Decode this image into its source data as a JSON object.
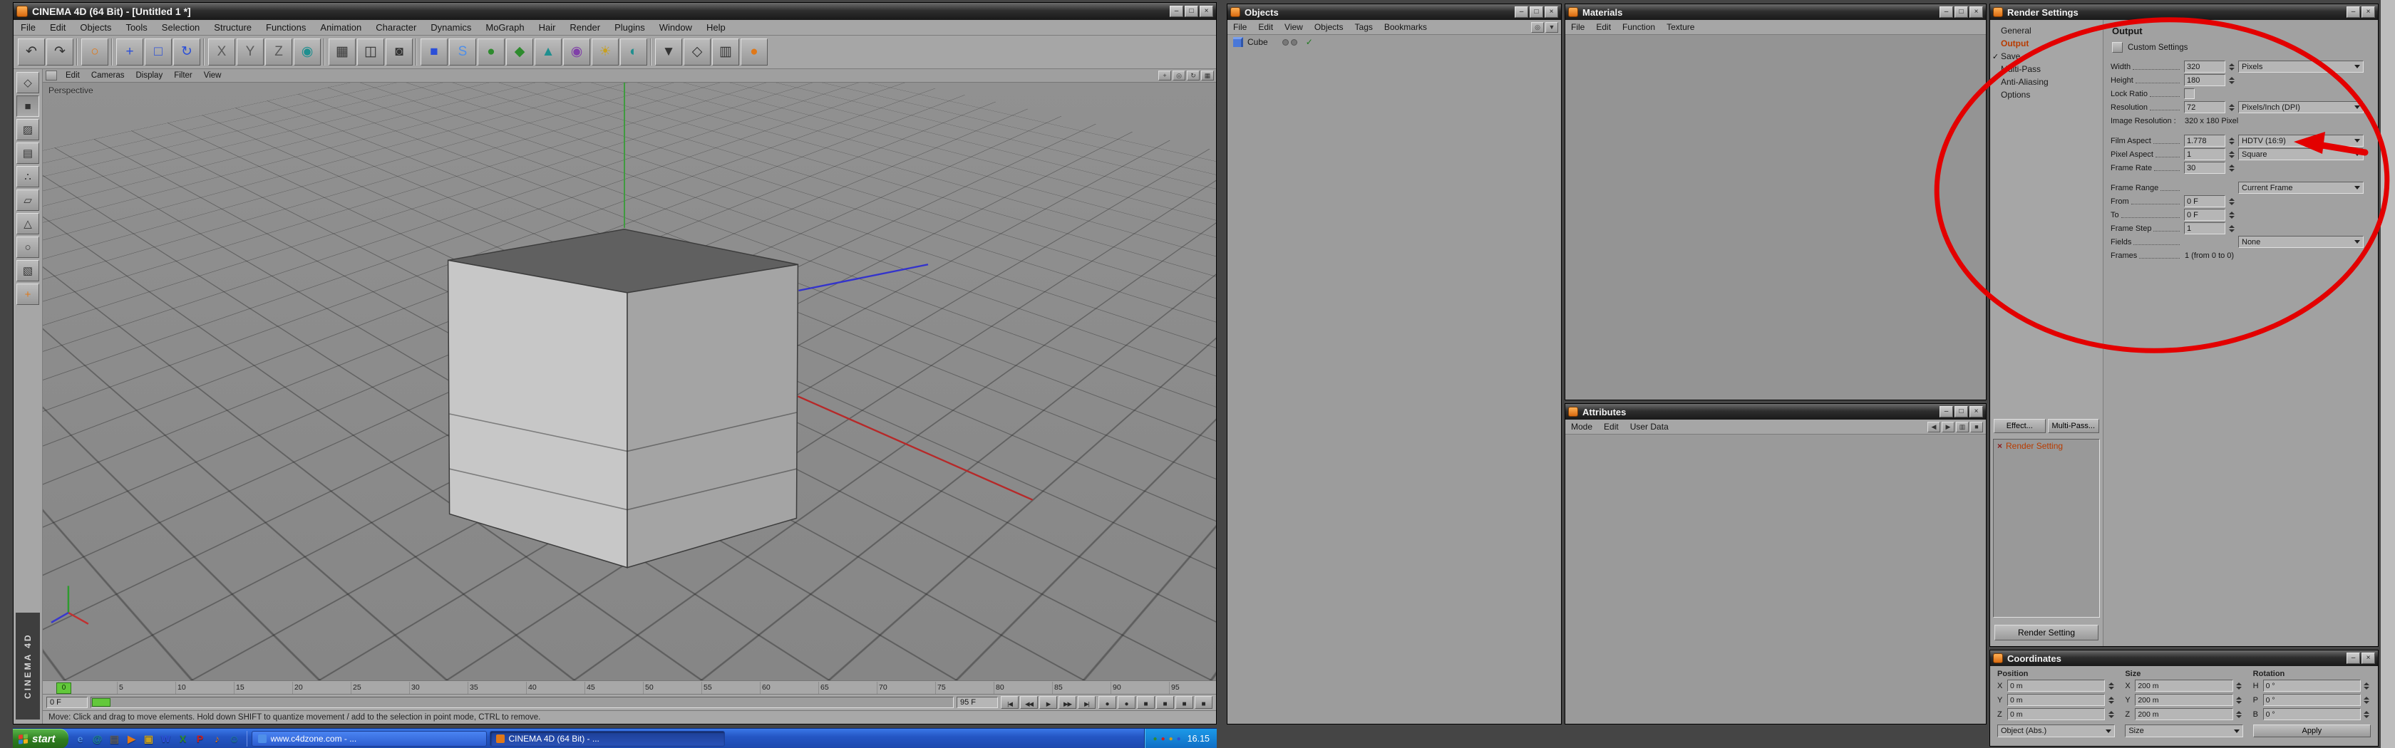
{
  "annotations": {
    "color": "#e30000"
  },
  "main_window": {
    "title": "CINEMA 4D (64 Bit) - [Untitled 1 *]",
    "brand": "CINEMA 4D",
    "menus": [
      "File",
      "Edit",
      "Objects",
      "Tools",
      "Selection",
      "Structure",
      "Functions",
      "Animation",
      "Character",
      "Dynamics",
      "MoGraph",
      "Hair",
      "Render",
      "Plugins",
      "Window",
      "Help"
    ],
    "window_buttons": [
      {
        "name": "minimize-button",
        "glyph": "–"
      },
      {
        "name": "maximize-button",
        "glyph": "□"
      },
      {
        "name": "close-button",
        "glyph": "×"
      }
    ],
    "toolbar_icons": [
      {
        "name": "undo-icon",
        "glyph": "↶",
        "tone": "dark"
      },
      {
        "name": "redo-icon",
        "glyph": "↷",
        "tone": "dark"
      },
      {
        "sep": true
      },
      {
        "name": "live-selection-icon",
        "glyph": "○",
        "tone": "orange"
      },
      {
        "sep": true
      },
      {
        "name": "move-icon",
        "glyph": "+",
        "tone": "blue"
      },
      {
        "name": "scale-icon",
        "glyph": "□",
        "tone": "blue"
      },
      {
        "name": "rotate-icon",
        "glyph": "↻",
        "tone": "blue"
      },
      {
        "sep": true
      },
      {
        "name": "lock-x-icon",
        "glyph": "X",
        "tone": "gray"
      },
      {
        "name": "lock-y-icon",
        "glyph": "Y",
        "tone": "gray"
      },
      {
        "name": "lock-z-icon",
        "glyph": "Z",
        "tone": "gray"
      },
      {
        "name": "coordinate-system-icon",
        "glyph": "◉",
        "tone": "teal"
      },
      {
        "sep": true
      },
      {
        "name": "render-view-icon",
        "glyph": "▦",
        "tone": "dark"
      },
      {
        "name": "render-picture-viewer-icon",
        "glyph": "◫",
        "tone": "dark"
      },
      {
        "name": "render-settings-icon",
        "glyph": "◙",
        "tone": "dark"
      },
      {
        "sep": true
      },
      {
        "name": "add-cube-icon",
        "glyph": "■",
        "tone": "blue"
      },
      {
        "name": "add-spline-icon",
        "glyph": "S",
        "tone": "lightblue"
      },
      {
        "name": "add-nurbs-icon",
        "glyph": "●",
        "tone": "green"
      },
      {
        "name": "add-modeling-icon",
        "glyph": "◆",
        "tone": "green"
      },
      {
        "name": "add-scene-icon",
        "glyph": "▲",
        "tone": "teal"
      },
      {
        "name": "add-camera-icon",
        "glyph": "◉",
        "tone": "purple"
      },
      {
        "name": "add-light-icon",
        "glyph": "☀",
        "tone": "yellow"
      },
      {
        "name": "add-environment-icon",
        "glyph": "◐",
        "tone": "teal"
      },
      {
        "sep": true
      },
      {
        "name": "selection-filter-icon",
        "glyph": "▼",
        "tone": "dark"
      },
      {
        "name": "snap-settings-icon",
        "glyph": "◇",
        "tone": "dark"
      },
      {
        "name": "viewport-layout-icon",
        "glyph": "▥",
        "tone": "dark"
      },
      {
        "name": "bodypaint-icon",
        "glyph": "●",
        "tone": "orange"
      }
    ],
    "palette_icons": [
      {
        "name": "convert-editable-icon",
        "glyph": "◇",
        "tone": "dark",
        "state": ""
      },
      {
        "name": "model-mode-icon",
        "glyph": "■",
        "tone": "dark",
        "state": "active"
      },
      {
        "name": "texture-mode-icon",
        "glyph": "▨",
        "tone": "dark",
        "state": ""
      },
      {
        "name": "workplane-mode-icon",
        "glyph": "▤",
        "tone": "dark",
        "state": ""
      },
      {
        "name": "points-mode-icon",
        "glyph": "∴",
        "tone": "dark",
        "state": ""
      },
      {
        "name": "edges-mode-icon",
        "glyph": "▱",
        "tone": "dark",
        "state": ""
      },
      {
        "name": "polygons-mode-icon",
        "glyph": "△",
        "tone": "dark",
        "state": ""
      },
      {
        "name": "animation-mode-icon",
        "glyph": "○",
        "tone": "dark",
        "state": ""
      },
      {
        "name": "texture-axis-icon",
        "glyph": "▧",
        "tone": "dark",
        "state": ""
      },
      {
        "name": "object-axis-icon",
        "glyph": "+",
        "tone": "orange",
        "state": ""
      }
    ],
    "viewport": {
      "label": "Perspective",
      "menus": [
        "Edit",
        "Cameras",
        "Display",
        "Filter",
        "View"
      ],
      "corner_icons": [
        {
          "name": "camera-pan-icon",
          "glyph": "+"
        },
        {
          "name": "camera-zoom-icon",
          "glyph": "◎"
        },
        {
          "name": "camera-rotate-icon",
          "glyph": "↻"
        },
        {
          "name": "toggle-view-icon",
          "glyph": "▦"
        }
      ]
    },
    "timeline": {
      "current": "0",
      "ticks": [
        "0",
        "5",
        "10",
        "15",
        "20",
        "25",
        "30",
        "35",
        "40",
        "45",
        "50",
        "55",
        "60",
        "65",
        "70",
        "75",
        "80",
        "85",
        "90",
        "95"
      ]
    },
    "transport": {
      "start": "0 F",
      "end": "95 F",
      "buttons": [
        {
          "name": "goto-start-button",
          "glyph": "|◀"
        },
        {
          "name": "previous-key-button",
          "glyph": "◀◀"
        },
        {
          "name": "play-button",
          "glyph": "▶"
        },
        {
          "name": "next-key-button",
          "glyph": "▶▶"
        },
        {
          "name": "goto-end-button",
          "glyph": "▶|"
        }
      ],
      "record": [
        {
          "name": "record-keyframe-button",
          "glyph": "●",
          "tone": "red"
        },
        {
          "name": "autokey-button",
          "glyph": "●",
          "tone": "gray"
        },
        {
          "name": "record-position-icon",
          "glyph": "■",
          "tone": "blue"
        },
        {
          "name": "record-scale-icon",
          "glyph": "■",
          "tone": "green"
        },
        {
          "name": "record-rotation-icon",
          "glyph": "■",
          "tone": "yellow"
        },
        {
          "name": "record-parameter-icon",
          "glyph": "■",
          "tone": "gray"
        }
      ]
    },
    "status": "Move: Click and drag to move elements. Hold down SHIFT to quantize movement / add to the selection in point mode, CTRL to remove."
  },
  "objects_window": {
    "title": "Objects",
    "menus": [
      "File",
      "Edit",
      "View",
      "Objects",
      "Tags",
      "Bookmarks"
    ],
    "menu_icons": [
      {
        "name": "search-icon",
        "glyph": "◎"
      },
      {
        "name": "scene-filter-icon",
        "glyph": "▼"
      }
    ],
    "window_buttons": [
      {
        "name": "minimize-button",
        "glyph": "–"
      },
      {
        "name": "maximize-button",
        "glyph": "□"
      },
      {
        "name": "close-button",
        "glyph": "×"
      }
    ],
    "items": [
      {
        "label": "Cube"
      }
    ],
    "check_glyph": "✓"
  },
  "materials_window": {
    "title": "Materials",
    "menus": [
      "File",
      "Edit",
      "Function",
      "Texture"
    ],
    "window_buttons": [
      {
        "name": "minimize-button",
        "glyph": "–"
      },
      {
        "name": "maximize-button",
        "glyph": "□"
      },
      {
        "name": "close-button",
        "glyph": "×"
      }
    ]
  },
  "attributes_window": {
    "title": "Attributes",
    "menus": [
      "Mode",
      "Edit",
      "User Data"
    ],
    "menu_icons": [
      {
        "name": "history-back-icon",
        "glyph": "◀"
      },
      {
        "name": "history-forward-icon",
        "glyph": "▶"
      },
      {
        "name": "copy-icon",
        "glyph": "▥"
      },
      {
        "name": "lock-icon",
        "glyph": "■"
      }
    ],
    "window_buttons": [
      {
        "name": "minimize-button",
        "glyph": "–"
      },
      {
        "name": "maximize-button",
        "glyph": "□"
      },
      {
        "name": "close-button",
        "glyph": "×"
      }
    ]
  },
  "render_settings": {
    "title": "Render Settings",
    "window_buttons": [
      {
        "name": "minimize-button",
        "glyph": "–"
      },
      {
        "name": "close-button",
        "glyph": "×"
      }
    ],
    "tree": [
      {
        "label": "General",
        "state": "",
        "mark": ""
      },
      {
        "label": "Output",
        "state": "selected",
        "mark": ""
      },
      {
        "label": "Save",
        "state": "",
        "mark": "✓"
      },
      {
        "label": "Multi-Pass",
        "state": "",
        "mark": ""
      },
      {
        "label": "Anti-Aliasing",
        "state": "",
        "mark": ""
      },
      {
        "label": "Options",
        "state": "",
        "mark": ""
      }
    ],
    "panel_title": "Output",
    "custom_settings": "Custom Settings",
    "rows": [
      {
        "label": "Width",
        "dots": true,
        "input": "320",
        "dropdown": "Pixels"
      },
      {
        "label": "Height",
        "dots": true,
        "input": "180"
      },
      {
        "label": "Lock Ratio",
        "dots": true,
        "checkbox": "unchecked"
      },
      {
        "label": "Resolution",
        "dots": true,
        "input": "72",
        "dropdown": "Pixels/Inch (DPI)"
      },
      {
        "label": "Image Resolution :",
        "text": "320 x 180 Pixel"
      },
      {
        "spacer": true
      },
      {
        "label": "Film Aspect",
        "dots": true,
        "input": "1.778",
        "dropdown": "HDTV (16:9)"
      },
      {
        "label": "Pixel Aspect",
        "dots": true,
        "input": "1",
        "dropdown": "Square"
      },
      {
        "label": "Frame Rate",
        "dots": true,
        "input": "30"
      },
      {
        "spacer": true
      },
      {
        "label": "Frame Range",
        "dots": true,
        "dropdown": "Current Frame"
      },
      {
        "label": "From",
        "dots": true,
        "input": "0 F"
      },
      {
        "label": "To",
        "dots": true,
        "input": "0 F"
      },
      {
        "label": "Frame Step",
        "dots": true,
        "input": "1"
      },
      {
        "label": "Fields",
        "dots": true,
        "dropdown": "None"
      },
      {
        "label": "Frames",
        "dots": true,
        "text": "1 (from 0 to 0)"
      }
    ],
    "effect_button": "Effect...",
    "multipass_button": "Multi-Pass...",
    "preset_mark": "×",
    "preset_item": "Render Setting",
    "new_button": "Render Setting"
  },
  "coordinates_window": {
    "title": "Coordinates",
    "window_buttons": [
      {
        "name": "minimize-button",
        "glyph": "–"
      },
      {
        "name": "close-button",
        "glyph": "×"
      }
    ],
    "headers": [
      "Position",
      "Size",
      "Rotation"
    ],
    "fields": [
      {
        "name": "position-x-field",
        "label": "X",
        "value": "0 m"
      },
      {
        "name": "position-y-field",
        "label": "Y",
        "value": "0 m"
      },
      {
        "name": "position-z-field",
        "label": "Z",
        "value": "0 m"
      },
      {
        "name": "size-x-field",
        "label": "X",
        "value": "200 m"
      },
      {
        "name": "size-y-field",
        "label": "Y",
        "value": "200 m"
      },
      {
        "name": "size-z-field",
        "label": "Z",
        "value": "200 m"
      },
      {
        "name": "rotation-h-field",
        "label": "H",
        "value": "0 °"
      },
      {
        "name": "rotation-p-field",
        "label": "P",
        "value": "0 °"
      },
      {
        "name": "rotation-b-field",
        "label": "B",
        "value": "0 °"
      }
    ],
    "system_dropdown": "Object (Abs.)",
    "size_dropdown": "Size",
    "apply_label": "Apply"
  },
  "taskbar": {
    "start_label": "start",
    "quick_launch": [
      {
        "name": "internet-explorer-icon",
        "glyph": "e",
        "tone": "lightblue"
      },
      {
        "name": "outlook-express-icon",
        "glyph": "@",
        "tone": "teal"
      },
      {
        "name": "show-desktop-icon",
        "glyph": "▤",
        "tone": "gray"
      },
      {
        "name": "media-player-icon",
        "glyph": "▶",
        "tone": "orange"
      },
      {
        "name": "folder-icon",
        "glyph": "▣",
        "tone": "yellow"
      },
      {
        "name": "word-icon",
        "glyph": "W",
        "tone": "blue"
      },
      {
        "name": "excel-icon",
        "glyph": "X",
        "tone": "green"
      },
      {
        "name": "paint-icon",
        "glyph": "P",
        "tone": "red"
      },
      {
        "name": "winamp-icon",
        "glyph": "♪",
        "tone": "orange"
      },
      {
        "name": "messenger-icon",
        "glyph": "☺",
        "tone": "teal"
      }
    ],
    "tasks": [
      {
        "name": "task-c4dzone",
        "label": "www.c4dzone.com - ...",
        "tone": "lightblue",
        "state": ""
      },
      {
        "name": "task-cinema4d",
        "label": "CINEMA 4D (64 Bit) - ...",
        "tone": "orange",
        "state": "active"
      }
    ],
    "tray_icons": [
      {
        "name": "antivirus-icon",
        "glyph": "●",
        "tone": "green"
      },
      {
        "name": "messenger-tray-icon",
        "glyph": "●",
        "tone": "red"
      },
      {
        "name": "volume-icon",
        "glyph": "●",
        "tone": "yellow"
      },
      {
        "name": "network-icon",
        "glyph": "●",
        "tone": "blue"
      }
    ],
    "clock": "16.15"
  }
}
